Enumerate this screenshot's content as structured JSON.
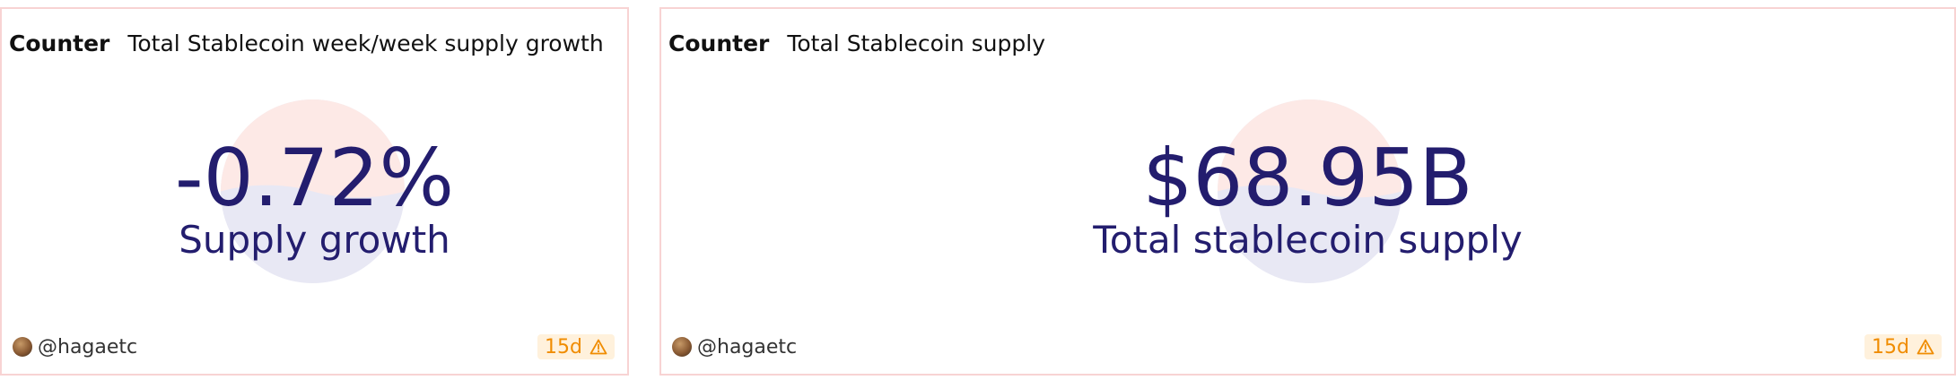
{
  "cards": [
    {
      "type_label": "Counter",
      "title": "Total Stablecoin week/week supply growth",
      "value": "-0.72%",
      "label": "Supply growth",
      "author": "@hagaetc",
      "age": "15d"
    },
    {
      "type_label": "Counter",
      "title": "Total Stablecoin supply",
      "value": "$68.95B",
      "label": "Total stablecoin supply",
      "author": "@hagaetc",
      "age": "15d"
    }
  ],
  "colors": {
    "value_text": "#231d6e",
    "card_border": "#f8d3d3",
    "age_text": "#f08c00",
    "age_badge_bg": "#fff1dc",
    "watermark_top": "#fde9e6",
    "watermark_bottom": "#e8e8f4"
  },
  "icons": {
    "watermark": "yin-yang-watermark-icon",
    "avatar": "avatar",
    "warning": "warning-triangle-icon"
  }
}
